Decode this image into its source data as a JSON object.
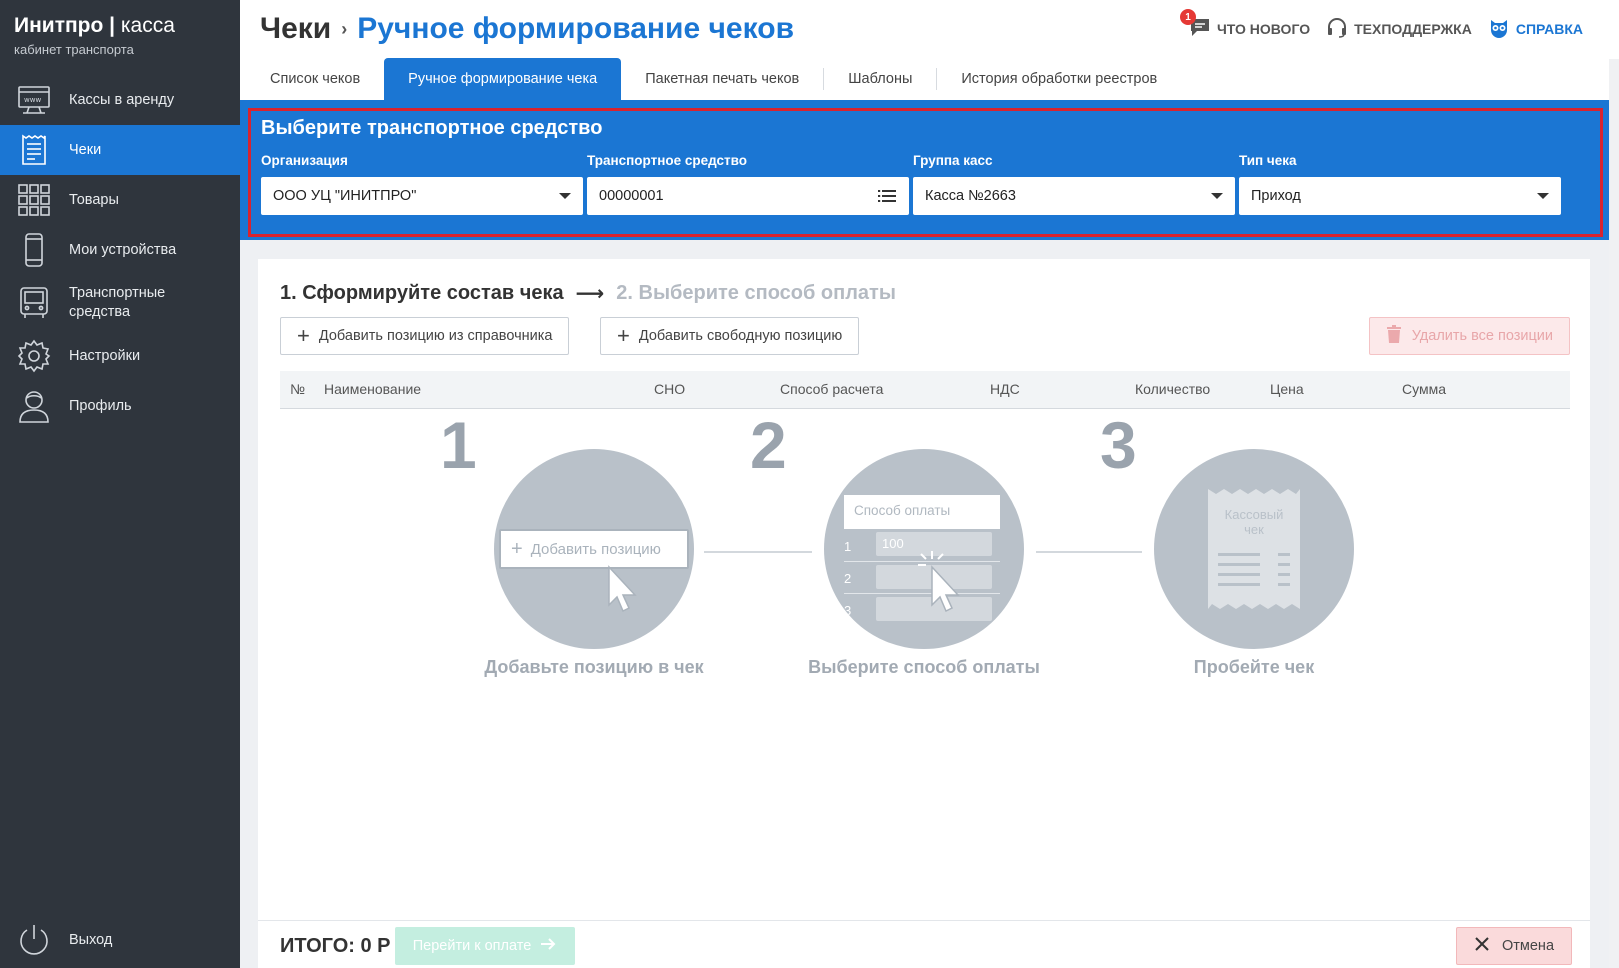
{
  "sidebar": {
    "logo_brand": "Инитпро",
    "logo_product": "касса",
    "logo_sub": "кабинет транспорта",
    "items": [
      {
        "label": "Кассы в аренду",
        "icon": "www-terminal-icon"
      },
      {
        "label": "Чеки",
        "icon": "receipt-icon",
        "active": true
      },
      {
        "label": "Товары",
        "icon": "grid-icon"
      },
      {
        "label": "Мои устройства",
        "icon": "smartphone-icon"
      },
      {
        "label": "Транспортные средства",
        "icon": "bus-icon"
      },
      {
        "label": "Настройки",
        "icon": "gear-icon"
      },
      {
        "label": "Профиль",
        "icon": "user-icon"
      }
    ],
    "exit_label": "Выход"
  },
  "header": {
    "breadcrumb_root": "Чеки",
    "breadcrumb_current": "Ручное формирование чеков",
    "whats_new": "Что нового",
    "whats_new_badge": "1",
    "support": "Техподдержка",
    "help": "Справка"
  },
  "tabs": [
    {
      "label": "Список чеков"
    },
    {
      "label": "Ручное формирование чека",
      "active": true
    },
    {
      "label": "Пакетная печать чеков"
    },
    {
      "label": "Шаблоны"
    },
    {
      "label": "История обработки реестров"
    }
  ],
  "vehicle": {
    "title": "Выберите транспортное средство",
    "org_label": "Организация",
    "org_value": "ООО УЦ \"ИНИТПРО\"",
    "vehicle_label": "Транспортное средство",
    "vehicle_value": "00000001",
    "group_label": "Группа касс",
    "group_value": "Касса №2663",
    "type_label": "Тип чека",
    "type_value": "Приход"
  },
  "main": {
    "step1": "1. Сформируйте состав чека",
    "step2": "2. Выберите способ оплаты",
    "add_from_catalog": "Добавить позицию из справочника",
    "add_free": "Добавить свободную позицию",
    "delete_all": "Удалить все позиции",
    "columns": [
      "№",
      "Наименование",
      "СНО",
      "Способ расчета",
      "НДС",
      "Количество",
      "Цена",
      "Сумма"
    ]
  },
  "illustration": {
    "num1": "1",
    "num2": "2",
    "num3": "3",
    "fake_add_button": "Добавить позицию",
    "fake_payment_header": "Способ оплаты",
    "fake_rows": [
      "1",
      "2",
      "3"
    ],
    "fake_value": "100",
    "fake_receipt": "Кассовый чек",
    "caption1": "Добавьте позицию в чек",
    "caption2": "Выберите способ оплаты",
    "caption3": "Пробейте чек"
  },
  "footer": {
    "total": "ИТОГО: 0 Р",
    "pay_button": "Перейти к оплате",
    "cancel_button": "Отмена"
  },
  "colors": {
    "accent": "#1b76d3",
    "sidebar": "#2f353d",
    "highlight_frame": "#d9232e"
  }
}
